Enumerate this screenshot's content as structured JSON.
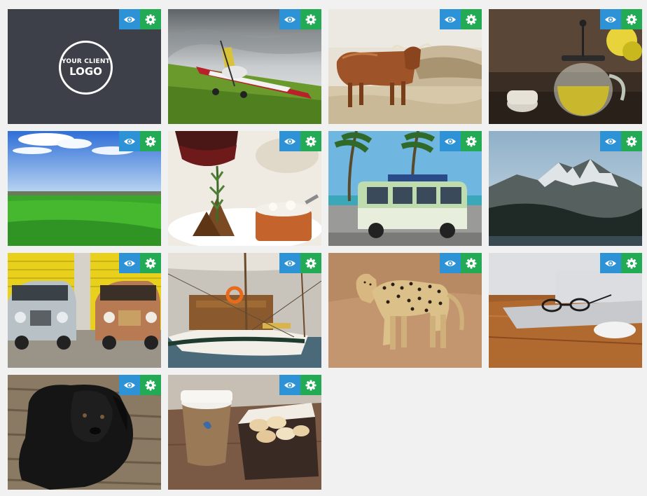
{
  "colors": {
    "page_background": "#f1f1f1",
    "view_button": "#2d92d6",
    "settings_button": "#22aa55",
    "logo_tile_background": "#3d4048"
  },
  "icons": {
    "view": "eye-icon",
    "settings": "gear-icon"
  },
  "logo": {
    "line1": "YOUR CLIENT",
    "line2": "LOGO"
  },
  "tiles": [
    {
      "subject": "client-logo"
    },
    {
      "subject": "airplane"
    },
    {
      "subject": "highland-cow"
    },
    {
      "subject": "teapot"
    },
    {
      "subject": "green-field"
    },
    {
      "subject": "food-plate"
    },
    {
      "subject": "vw-van"
    },
    {
      "subject": "mountain"
    },
    {
      "subject": "vintage-cars"
    },
    {
      "subject": "sailboat"
    },
    {
      "subject": "leopard"
    },
    {
      "subject": "laptop-glasses"
    },
    {
      "subject": "black-puppy"
    },
    {
      "subject": "coffee-macarons"
    }
  ]
}
